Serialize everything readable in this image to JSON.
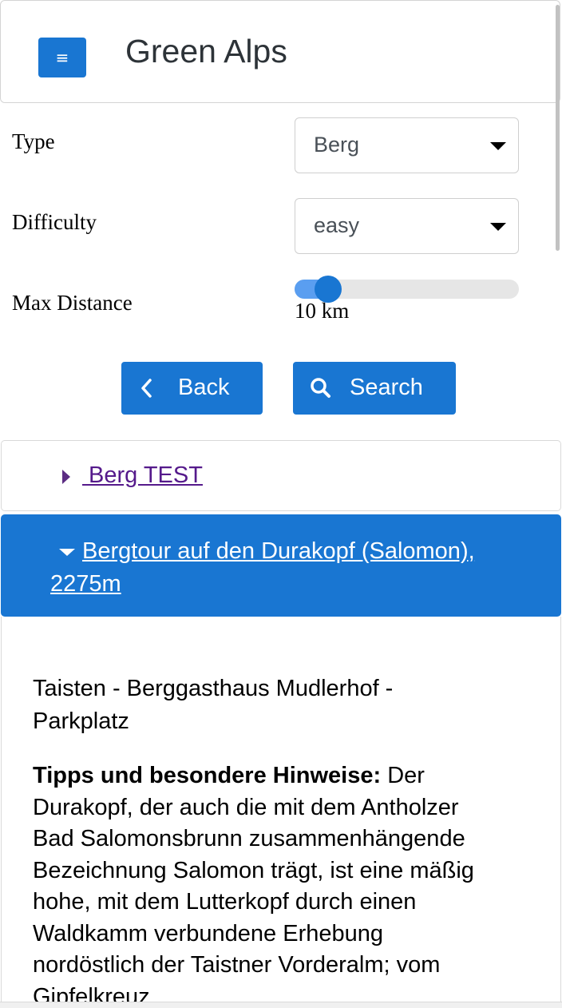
{
  "header": {
    "menu_icon": "hamburger-menu-icon",
    "title": "Green Alps"
  },
  "filters": {
    "type_label": "Type",
    "type_value": "Berg",
    "difficulty_label": "Difficulty",
    "difficulty_value": "easy",
    "distance_label": "Max Distance",
    "distance_value_text": "10 km",
    "distance_fraction": 0.1
  },
  "buttons": {
    "back_label": "Back",
    "back_icon": "chevron-left-icon",
    "search_label": "Search",
    "search_icon": "search-icon"
  },
  "results": [
    {
      "title": " Berg TEST",
      "expanded": false
    },
    {
      "title": " Bergtour auf den Durakopf (Salomon), 2275m",
      "expanded": true
    }
  ],
  "detail": {
    "route": "Taisten - Berggasthaus Mudlerhof - Parkplatz",
    "tips_heading": "Tipps und besondere Hinweise:",
    "tips_text": " Der Durakopf, der auch die mit dem Antholzer Bad Salomonsbrunn zusammenhängende Bezeichnung Salomon trägt, ist eine mäßig hohe, mit dem Lutterkopf durch einen Waldkamm verbundene Erhebung nordöstlich der Taistner Vorderalm; vom Gipfelkreuz"
  },
  "colors": {
    "primary": "#1976d2",
    "visited_link": "#551a8b"
  }
}
